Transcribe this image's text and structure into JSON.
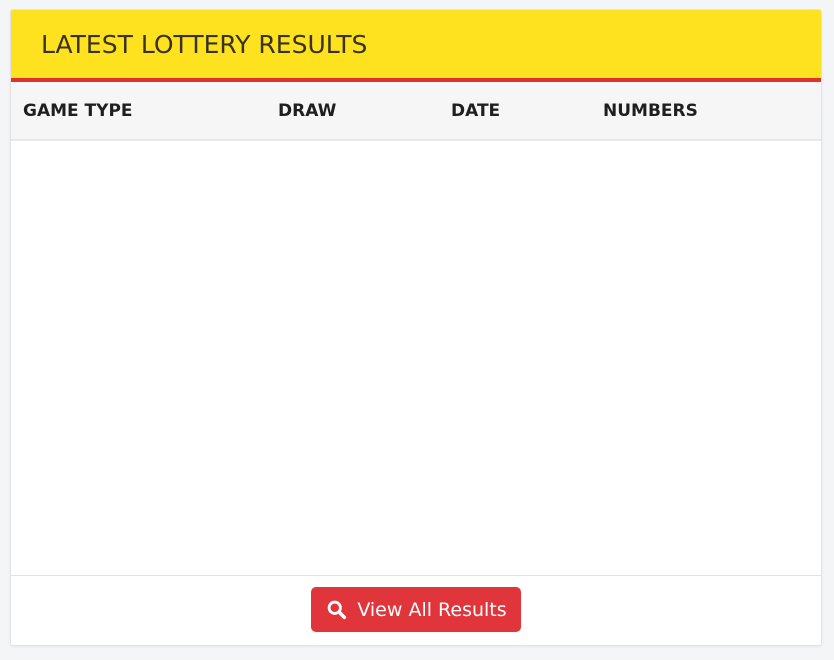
{
  "panel": {
    "title": "LATEST LOTTERY RESULTS"
  },
  "table": {
    "columns": [
      "GAME TYPE",
      "DRAW",
      "DATE",
      "NUMBERS"
    ],
    "rows": []
  },
  "footer": {
    "view_all_label": "View All Results",
    "button_icon": "search-icon"
  },
  "colors": {
    "header_background": "#ffe21f",
    "header_accent": "#e03131",
    "button_background": "#e0353b"
  }
}
